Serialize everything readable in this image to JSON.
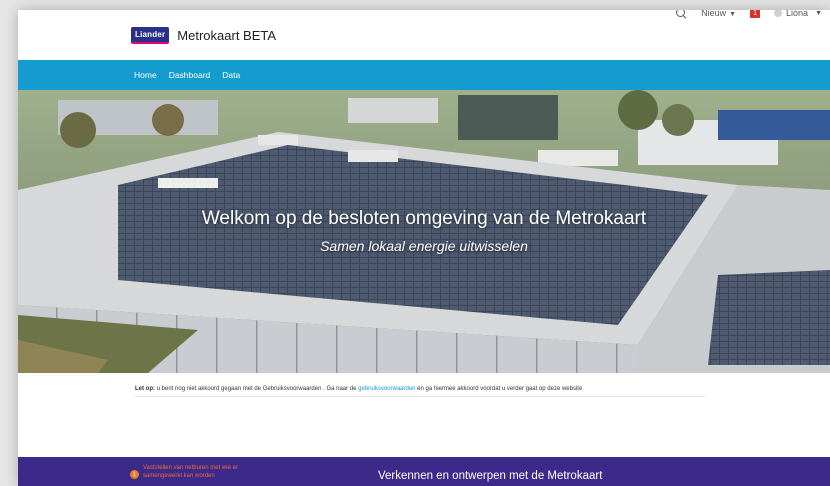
{
  "header": {
    "logo_text": "Liander",
    "app_title": "Metrokaart BETA"
  },
  "utility": {
    "new_label": "Nieuw",
    "notification_count": "1",
    "user_name": "Liona"
  },
  "nav": {
    "items": [
      {
        "label": "Home"
      },
      {
        "label": "Dashboard"
      },
      {
        "label": "Data"
      }
    ]
  },
  "hero": {
    "title": "Welkom op de besloten omgeving van de Metrokaart",
    "subtitle": "Samen lokaal energie uitwisselen"
  },
  "notice": {
    "prefix": "Let op:",
    "text_before_link": " u bent nog niet akkoord gegaan met de Gebruiksvoorwaarden . Ga naar de ",
    "link": "gebruiksvoorwaarden",
    "text_after_link": " en ga hiermee akkoord voordat u verder gaat op deze website"
  },
  "footer": {
    "warning_number": "1",
    "warning_text": "Vaststellen van netburen met wie er samengewerkt kan worden",
    "title": "Verkennen en ontwerpen met de Metrokaart"
  },
  "colors": {
    "nav_bg": "#159ccf",
    "footer_bg": "#3b2a8a",
    "warning": "#f07a28",
    "notification_badge": "#d9322a"
  }
}
